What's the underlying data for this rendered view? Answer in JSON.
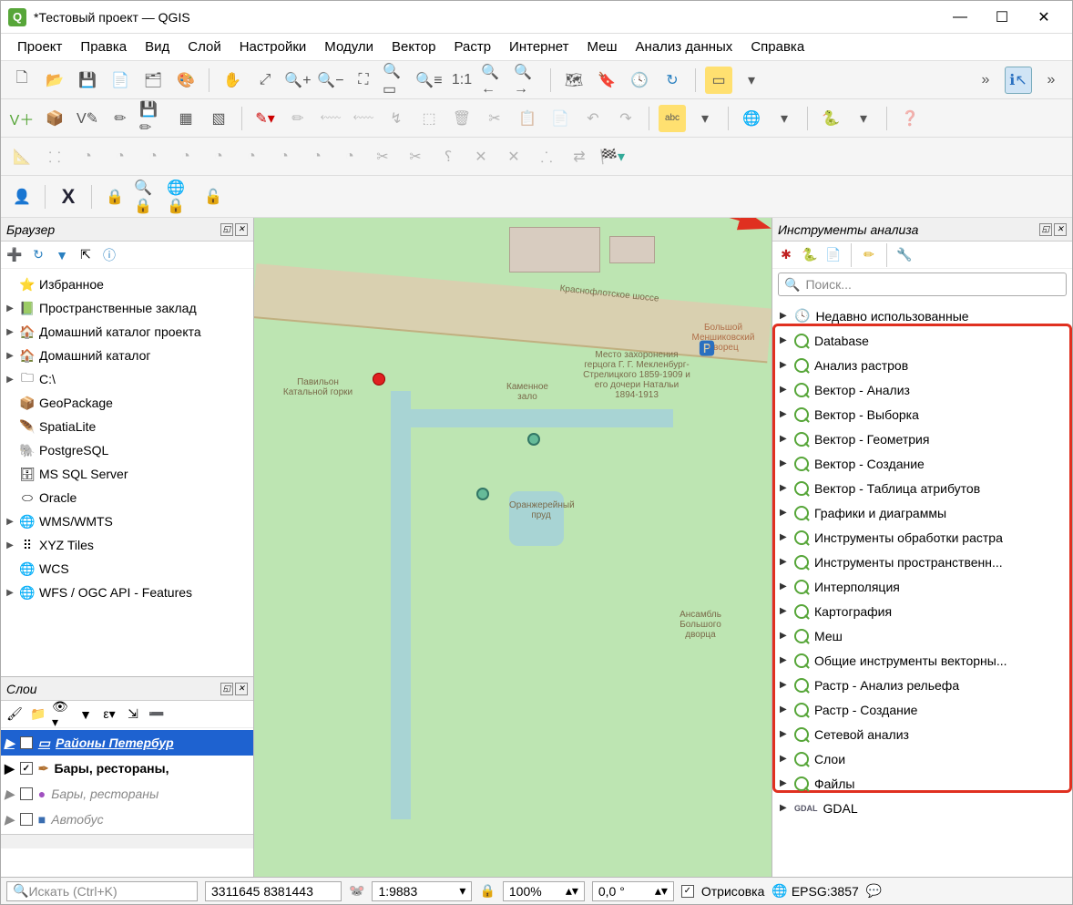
{
  "title": "*Тестовый проект — QGIS",
  "menus": [
    "Проект",
    "Правка",
    "Вид",
    "Слой",
    "Настройки",
    "Модули",
    "Вектор",
    "Растр",
    "Интернет",
    "Меш",
    "Анализ данных",
    "Справка"
  ],
  "browser": {
    "title": "Браузер",
    "items": [
      {
        "exp": "",
        "icon": "⭐",
        "label": "Избранное"
      },
      {
        "exp": "▶",
        "icon": "📗",
        "label": "Пространственные заклад"
      },
      {
        "exp": "▶",
        "icon": "🏠",
        "label": "Домашний каталог проекта"
      },
      {
        "exp": "▶",
        "icon": "🏠",
        "label": "Домашний каталог"
      },
      {
        "exp": "▶",
        "icon": "🗀",
        "label": "C:\\"
      },
      {
        "exp": "",
        "icon": "📦",
        "label": "GeoPackage"
      },
      {
        "exp": "",
        "icon": "🪶",
        "label": "SpatiaLite"
      },
      {
        "exp": "",
        "icon": "🐘",
        "label": "PostgreSQL"
      },
      {
        "exp": "",
        "icon": "🗄",
        "label": "MS SQL Server"
      },
      {
        "exp": "",
        "icon": "⬭",
        "label": "Oracle"
      },
      {
        "exp": "▶",
        "icon": "🌐",
        "label": "WMS/WMTS"
      },
      {
        "exp": "▶",
        "icon": "⠿",
        "label": "XYZ Tiles"
      },
      {
        "exp": "",
        "icon": "🌐",
        "label": "WCS"
      },
      {
        "exp": "▶",
        "icon": "🌐",
        "label": "WFS / OGC API - Features"
      }
    ]
  },
  "layers": {
    "title": "Слои",
    "items": [
      {
        "checked": false,
        "sel": true,
        "icon": "▭",
        "label": "Районы Петербур"
      },
      {
        "checked": true,
        "sel": false,
        "icon": "✒",
        "label": "Бары, рестораны,"
      },
      {
        "checked": false,
        "sel": false,
        "dim": true,
        "icon": "●",
        "label": "Бары, рестораны"
      },
      {
        "checked": false,
        "sel": false,
        "dim": true,
        "icon": "■",
        "label": "Автобус"
      }
    ]
  },
  "processing": {
    "title": "Инструменты анализа",
    "search_placeholder": "Поиск...",
    "items": [
      {
        "icon": "clock",
        "label": "Недавно использованные",
        "hl": false
      },
      {
        "icon": "q",
        "label": "Database",
        "hl": true
      },
      {
        "icon": "q",
        "label": "Анализ растров",
        "hl": true
      },
      {
        "icon": "q",
        "label": "Вектор - Анализ",
        "hl": true
      },
      {
        "icon": "q",
        "label": "Вектор - Выборка",
        "hl": true
      },
      {
        "icon": "q",
        "label": "Вектор - Геометрия",
        "hl": true
      },
      {
        "icon": "q",
        "label": "Вектор - Создание",
        "hl": true
      },
      {
        "icon": "q",
        "label": "Вектор - Таблица атрибутов",
        "hl": true
      },
      {
        "icon": "q",
        "label": "Графики и диаграммы",
        "hl": true
      },
      {
        "icon": "q",
        "label": "Инструменты обработки растра",
        "hl": true
      },
      {
        "icon": "q",
        "label": "Инструменты пространственн...",
        "hl": true
      },
      {
        "icon": "q",
        "label": "Интерполяция",
        "hl": true
      },
      {
        "icon": "q",
        "label": "Картография",
        "hl": true
      },
      {
        "icon": "q",
        "label": "Меш",
        "hl": true
      },
      {
        "icon": "q",
        "label": "Общие инструменты векторны...",
        "hl": true
      },
      {
        "icon": "q",
        "label": "Растр - Анализ рельефа",
        "hl": true
      },
      {
        "icon": "q",
        "label": "Растр - Создание",
        "hl": true
      },
      {
        "icon": "q",
        "label": "Сетевой анализ",
        "hl": true
      },
      {
        "icon": "q",
        "label": "Слои",
        "hl": true
      },
      {
        "icon": "q",
        "label": "Файлы",
        "hl": true
      },
      {
        "icon": "gdal",
        "label": "GDAL",
        "hl": false
      }
    ]
  },
  "status": {
    "search_placeholder": "Искать (Ctrl+K)",
    "coords": "3311645 8381443",
    "scale": "1:9883",
    "zoom": "100%",
    "rotation": "0,0 °",
    "render_label": "Отрисовка",
    "crs": "EPSG:3857"
  },
  "map_labels": {
    "highway": "Краснофлотское шоссе",
    "pavilion": "Павильон Катальной горки",
    "kamennoe": "Каменное зало",
    "burial": "Место захоронения герцога Г. Г. Мекленбург-Стрелицкого 1859-1909 и его дочери Натальи 1894-1913",
    "menshikov": "Большой Меншиковский дворец",
    "orangery": "Оранжерейный пруд",
    "ensemble": "Ансамбль Большого дворца"
  }
}
